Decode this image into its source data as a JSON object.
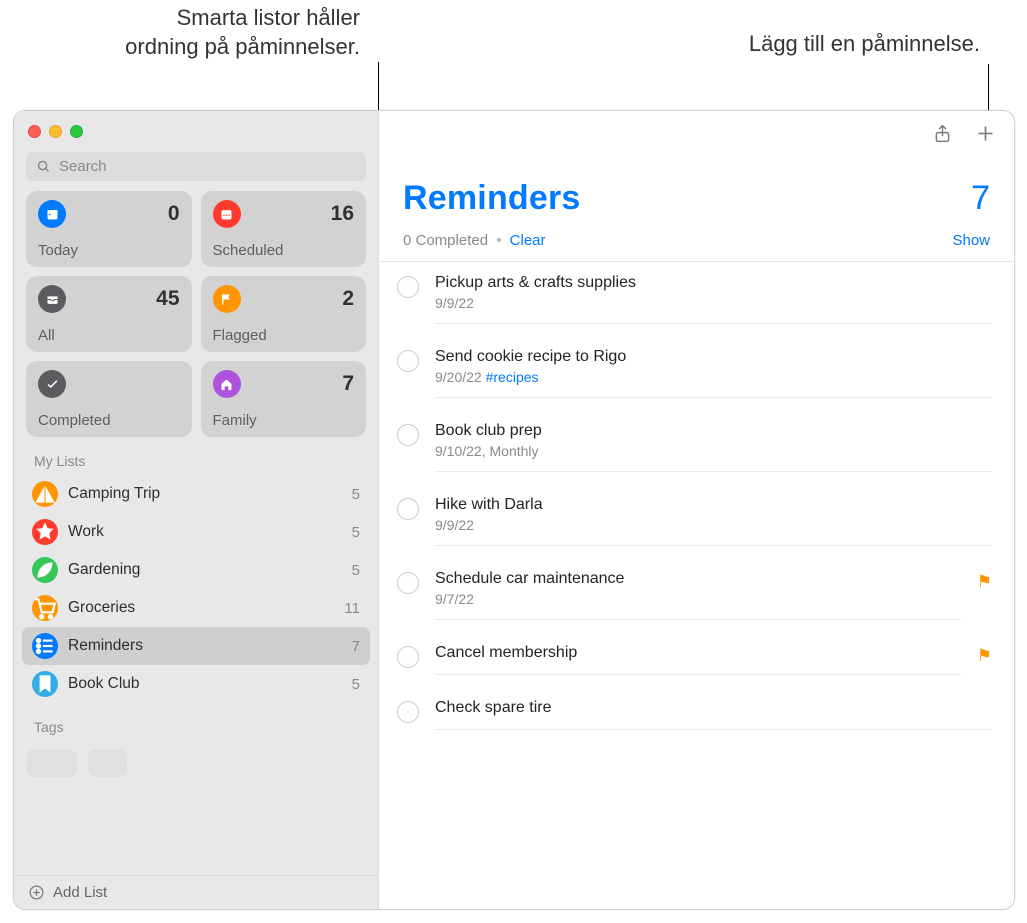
{
  "callouts": {
    "left_line1": "Smarta listor håller",
    "left_line2": "ordning på påminnelser.",
    "right": "Lägg till en påminnelse."
  },
  "search": {
    "placeholder": "Search"
  },
  "smart_lists": [
    {
      "label": "Today",
      "count": "0",
      "icon": "calendar-icon",
      "color": "ic-blue"
    },
    {
      "label": "Scheduled",
      "count": "16",
      "icon": "calendar-dots-icon",
      "color": "ic-red"
    },
    {
      "label": "All",
      "count": "45",
      "icon": "tray-icon",
      "color": "ic-dark"
    },
    {
      "label": "Flagged",
      "count": "2",
      "icon": "flag-icon",
      "color": "ic-orange"
    },
    {
      "label": "Completed",
      "count": "",
      "icon": "check-icon",
      "color": "ic-dark"
    },
    {
      "label": "Family",
      "count": "7",
      "icon": "house-icon",
      "color": "ic-purple"
    }
  ],
  "my_lists_header": "My Lists",
  "my_lists": [
    {
      "name": "Camping Trip",
      "count": "5",
      "color": "li-orange",
      "icon": "tent-icon",
      "selected": false
    },
    {
      "name": "Work",
      "count": "5",
      "color": "li-red",
      "icon": "star-icon",
      "selected": false
    },
    {
      "name": "Gardening",
      "count": "5",
      "color": "li-green",
      "icon": "leaf-icon",
      "selected": false
    },
    {
      "name": "Groceries",
      "count": "11",
      "color": "li-yellow",
      "icon": "cart-icon",
      "selected": false
    },
    {
      "name": "Reminders",
      "count": "7",
      "color": "li-blue",
      "icon": "list-icon",
      "selected": true
    },
    {
      "name": "Book Club",
      "count": "5",
      "color": "li-lblue",
      "icon": "bookmark-icon",
      "selected": false
    }
  ],
  "tags_header": "Tags",
  "add_list_label": "Add List",
  "main": {
    "title": "Reminders",
    "count": "7",
    "completed_text": "0 Completed",
    "clear_text": "Clear",
    "show_text": "Show"
  },
  "reminders": [
    {
      "title": "Pickup arts & crafts supplies",
      "meta": "9/9/22",
      "flagged": false,
      "tag": ""
    },
    {
      "title": "Send cookie recipe to Rigo",
      "meta": "9/20/22 ",
      "flagged": false,
      "tag": "#recipes"
    },
    {
      "title": "Book club prep",
      "meta": "9/10/22, Monthly",
      "flagged": false,
      "tag": ""
    },
    {
      "title": "Hike with Darla",
      "meta": "9/9/22",
      "flagged": false,
      "tag": ""
    },
    {
      "title": "Schedule car maintenance",
      "meta": "9/7/22",
      "flagged": true,
      "tag": ""
    },
    {
      "title": "Cancel membership",
      "meta": "",
      "flagged": true,
      "tag": ""
    },
    {
      "title": "Check spare tire",
      "meta": "",
      "flagged": false,
      "tag": ""
    }
  ]
}
